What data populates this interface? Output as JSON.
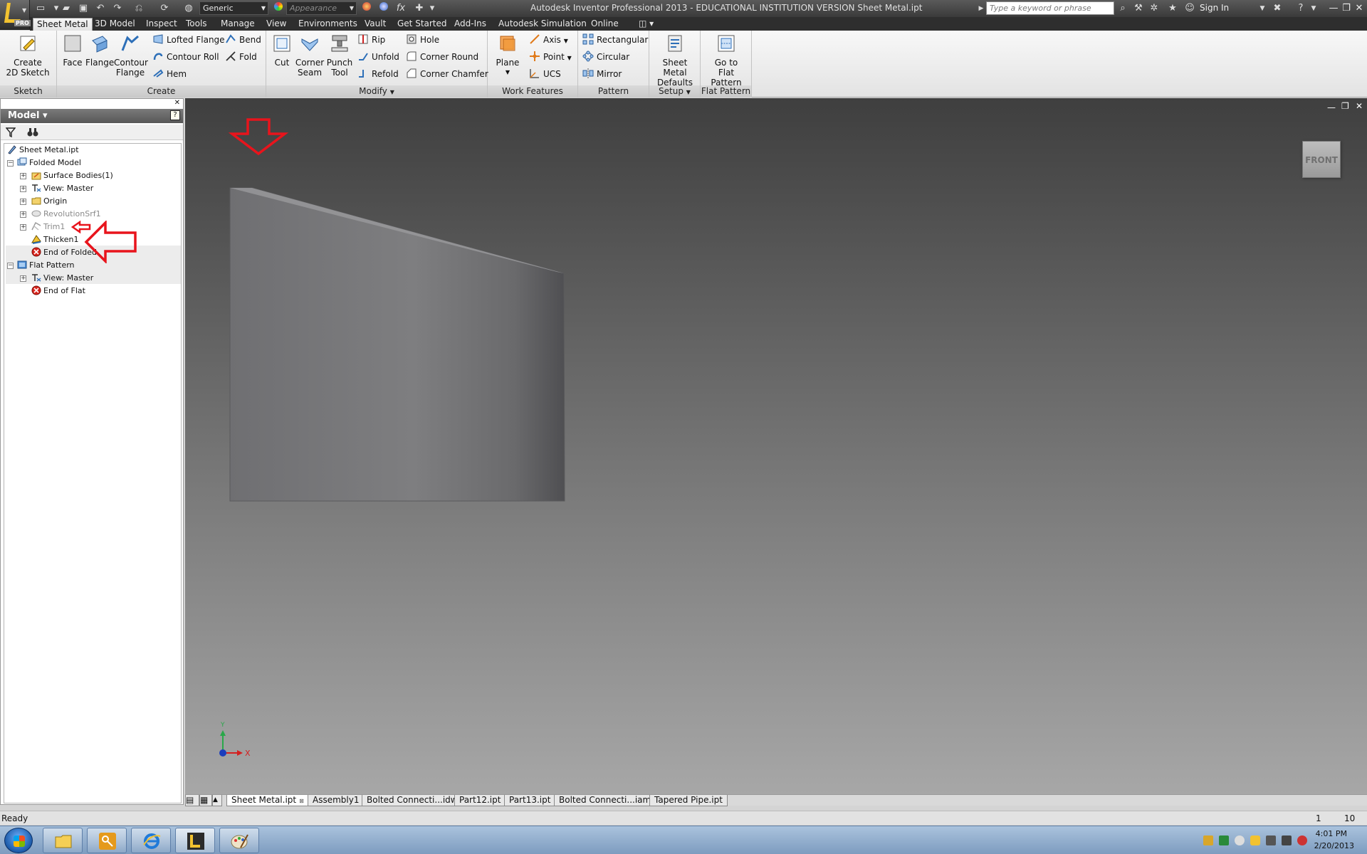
{
  "app": {
    "title": "Autodesk Inventor Professional 2013 - EDUCATIONAL INSTITUTION VERSION    Sheet Metal.ipt",
    "pro_badge": "PRO"
  },
  "quick_access": {
    "material_value": "Generic",
    "appearance_placeholder": "Appearance",
    "formula_icon": "fx"
  },
  "titlebar": {
    "search_placeholder": "Type a keyword or phrase",
    "sign_in": "Sign In"
  },
  "ribbon_tabs": [
    "Sheet Metal",
    "3D Model",
    "Inspect",
    "Tools",
    "Manage",
    "View",
    "Environments",
    "Vault",
    "Get Started",
    "Add-Ins",
    "Autodesk Simulation",
    "Online"
  ],
  "ribbon": {
    "sketch": {
      "title": "Sketch",
      "create_2d_sketch": "Create\n2D Sketch"
    },
    "create": {
      "title": "Create",
      "face": "Face",
      "flange": "Flange",
      "contour_flange": "Contour\nFlange",
      "lofted_flange": "Lofted Flange",
      "contour_roll": "Contour Roll",
      "hem": "Hem",
      "bend": "Bend",
      "fold": "Fold"
    },
    "modify": {
      "title": "Modify",
      "cut": "Cut",
      "corner_seam": "Corner\nSeam",
      "punch_tool": "Punch\nTool",
      "rip": "Rip",
      "unfold": "Unfold",
      "refold": "Refold",
      "hole": "Hole",
      "corner_round": "Corner Round",
      "corner_chamfer": "Corner Chamfer"
    },
    "work_features": {
      "title": "Work Features",
      "plane": "Plane",
      "axis": "Axis",
      "point": "Point",
      "ucs": "UCS"
    },
    "pattern": {
      "title": "Pattern",
      "rectangular": "Rectangular",
      "circular": "Circular",
      "mirror": "Mirror"
    },
    "setup": {
      "title": "Setup",
      "sheet_metal_defaults": "Sheet Metal\nDefaults"
    },
    "flat_pattern": {
      "title": "Flat Pattern",
      "go_to_flat_pattern": "Go to\nFlat Pattern"
    }
  },
  "browser": {
    "title": "Model",
    "help": "?",
    "tree": [
      {
        "label": "Sheet Metal.ipt"
      },
      {
        "label": "Folded Model"
      },
      {
        "label": "Surface Bodies(1)"
      },
      {
        "label": "View: Master"
      },
      {
        "label": "Origin"
      },
      {
        "label": "RevolutionSrf1"
      },
      {
        "label": "Trim1"
      },
      {
        "label": "Thicken1"
      },
      {
        "label": "End of Folded"
      },
      {
        "label": "Flat Pattern"
      },
      {
        "label": "View: Master"
      },
      {
        "label": "End of Flat"
      }
    ]
  },
  "viewport": {
    "viewcube_label": "FRONT",
    "axis_x": "X",
    "axis_y": "Y"
  },
  "doc_tabs": [
    "Sheet Metal.ipt",
    "Assembly1",
    "Bolted Connecti...idw",
    "Part12.ipt",
    "Part13.ipt",
    "Bolted Connecti...iam",
    "Tapered Pipe.ipt"
  ],
  "status": {
    "text": "Ready",
    "num1": "1",
    "num2": "10"
  },
  "taskbar": {
    "time": "4:01 PM",
    "date": "2/20/2013"
  },
  "colors": {
    "annotation_red": "#e8141c",
    "part_grey": "#7a7a7c",
    "accent_yellow": "#f2c230"
  }
}
